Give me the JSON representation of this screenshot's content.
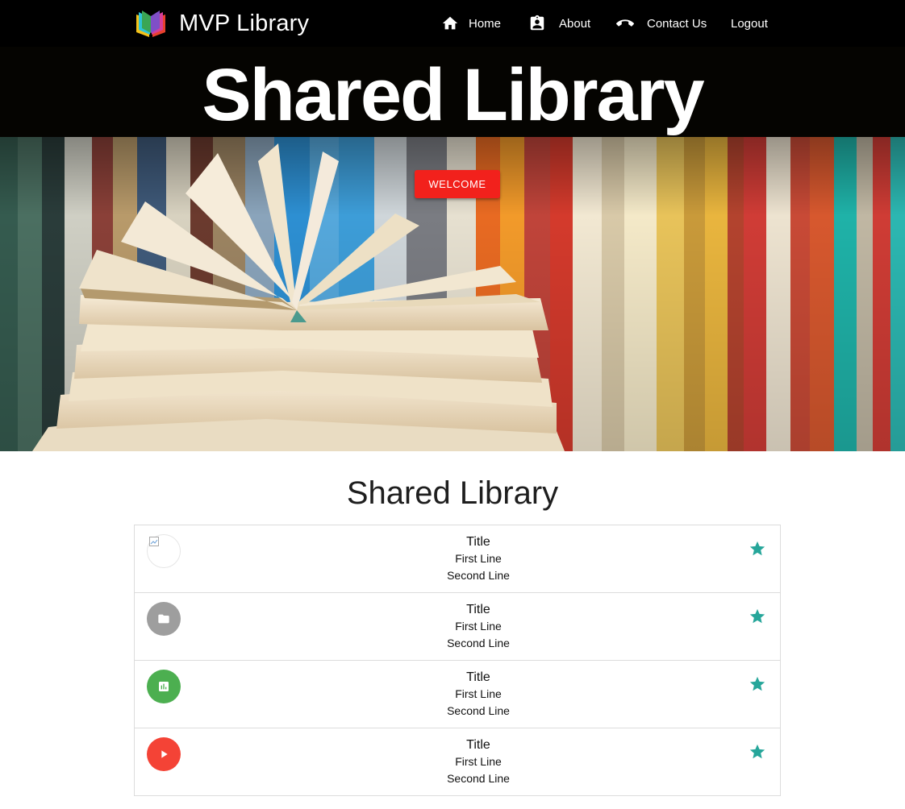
{
  "navbar": {
    "brand_name": "MVP Library",
    "logo_icon": "book-logo-icon",
    "links": [
      {
        "label": "Home",
        "icon": "home-icon"
      },
      {
        "label": "About",
        "icon": "contact-card-icon"
      },
      {
        "label": "Contact Us",
        "icon": "phone-icon"
      },
      {
        "label": "Logout"
      }
    ]
  },
  "banner": {
    "title": "Shared Library"
  },
  "hero": {
    "welcome_label": "WELCOME",
    "button_color": "#f2211c"
  },
  "section": {
    "title": "Shared Library"
  },
  "list": {
    "items": [
      {
        "title": "Title",
        "first_line": "First Line",
        "second_line": "Second Line",
        "avatar": "broken-image",
        "avatar_color": "#ffffff",
        "starred": true
      },
      {
        "title": "Title",
        "first_line": "First Line",
        "second_line": "Second Line",
        "avatar": "folder-icon",
        "avatar_color": "#9e9e9e",
        "starred": true
      },
      {
        "title": "Title",
        "first_line": "First Line",
        "second_line": "Second Line",
        "avatar": "chart-icon",
        "avatar_color": "#4caf50",
        "starred": true
      },
      {
        "title": "Title",
        "first_line": "First Line",
        "second_line": "Second Line",
        "avatar": "play-icon",
        "avatar_color": "#f44336",
        "starred": true
      }
    ],
    "star_color": "#26a69a"
  }
}
